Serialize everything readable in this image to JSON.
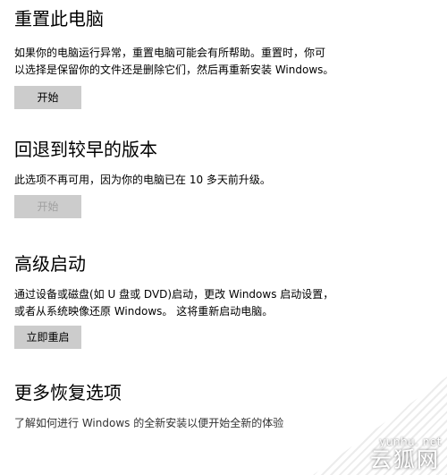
{
  "reset": {
    "title": "重置此电脑",
    "description_line1": "如果你的电脑运行异常，重置电脑可能会有所帮助。重置时，你可",
    "description_line2": "以选择是保留你的文件还是删除它们，然后再重新安装 Windows。",
    "button_label": "开始"
  },
  "rollback": {
    "title": "回退到较早的版本",
    "description": "此选项不再可用，因为你的电脑已在 10 多天前升级。",
    "button_label": "开始",
    "button_enabled": false
  },
  "advanced": {
    "title": "高级启动",
    "description_line1": "通过设备或磁盘(如 U 盘或 DVD)启动，更改 Windows 启动设置，",
    "description_line2": "或者从系统映像还原 Windows。 这将重新启动电脑。",
    "button_label": "立即重启"
  },
  "more": {
    "title": "更多恢复选项",
    "link_text": "了解如何进行 Windows 的全新安装以便开始全新的体验"
  },
  "watermark": {
    "url": "yunhu. net",
    "brand": "云狐网"
  },
  "colors": {
    "button_bg": "#cccccc",
    "disabled_text": "#a0a0a0",
    "text": "#000000"
  }
}
